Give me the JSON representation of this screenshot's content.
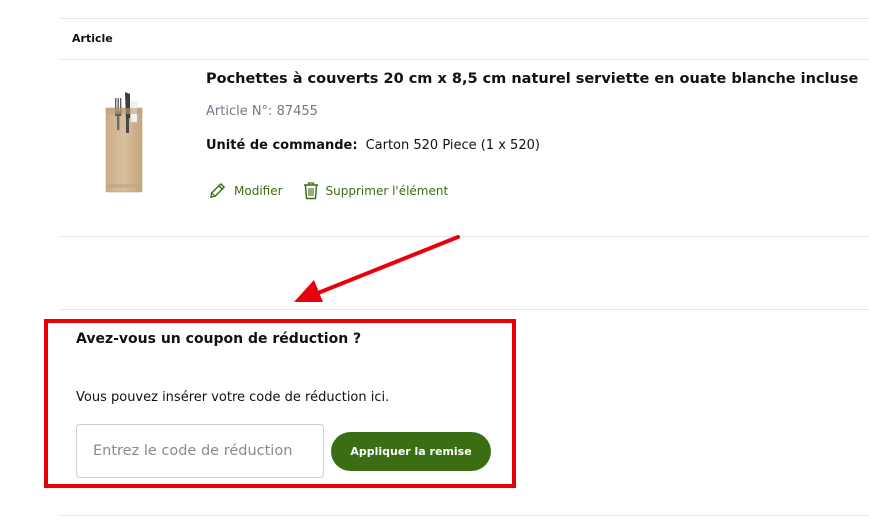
{
  "cart": {
    "column_header": "Article",
    "item": {
      "title": "Pochettes à couverts 20 cm x 8,5 cm naturel serviette en ouate blanche incluse",
      "article_number": "Article N°: 87455",
      "order_unit_label": "Unité de commande:",
      "order_unit_value": "Carton 520 Piece (1 x 520)",
      "edit_label": "Modifier",
      "delete_label": "Supprimer l'élément",
      "thumbnail_icon": "cutlery-pouch-image"
    }
  },
  "coupon": {
    "title": "Avez-vous un coupon de réduction ?",
    "description": "Vous pouvez insérer votre code de réduction ici.",
    "input_placeholder": "Entrez le code de réduction",
    "input_value": "",
    "apply_label": "Appliquer la remise"
  },
  "annotation": {
    "highlight_color": "#e8000b",
    "arrow_color": "#e8000b"
  },
  "theme": {
    "accent": "#3b6e12",
    "link": "#3c6d15"
  }
}
